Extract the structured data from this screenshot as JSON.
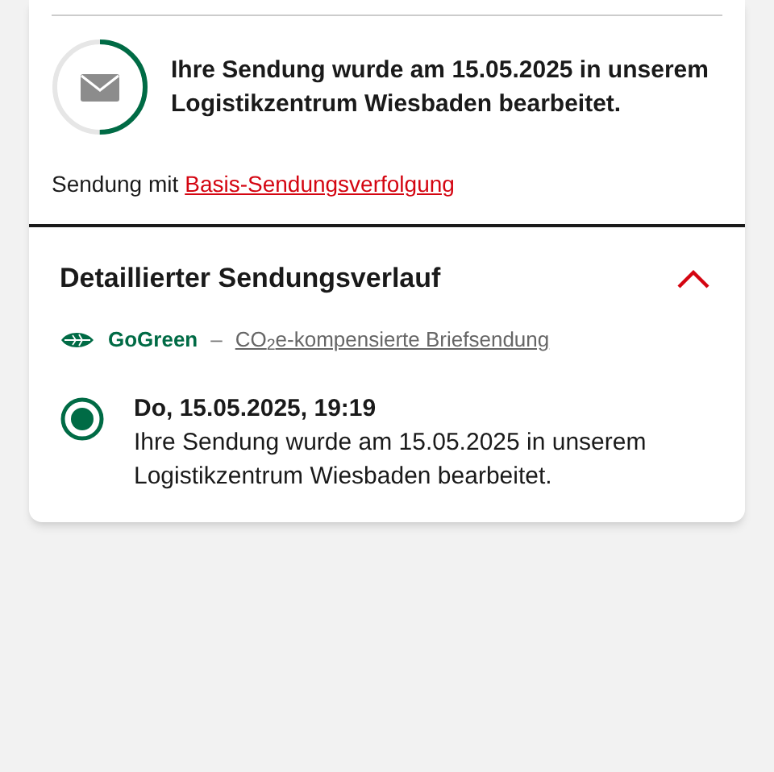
{
  "status": {
    "level": 0.5,
    "message": "Ihre Sendung wurde am 15.05.2025 in unserem Logistikzentrum Wiesbaden bearbeitet."
  },
  "tracking": {
    "prefix": "Sendung mit",
    "link": "Basis-Sendungsverfolgung"
  },
  "history": {
    "title": "Detaillierter Sendungsverlauf",
    "expanded": true,
    "gogreen": {
      "label": "GoGreen",
      "separator": "–",
      "link": "CO$_{2}$e-kompensierte Briefsendung"
    },
    "events": [
      {
        "date": "Do, 15.05.2025, 19:19",
        "text": "Ihre Sendung wurde am 15.05.2025 in unserem Logistikzentrum Wiesbaden bearbeitet.",
        "selected": true
      }
    ]
  }
}
